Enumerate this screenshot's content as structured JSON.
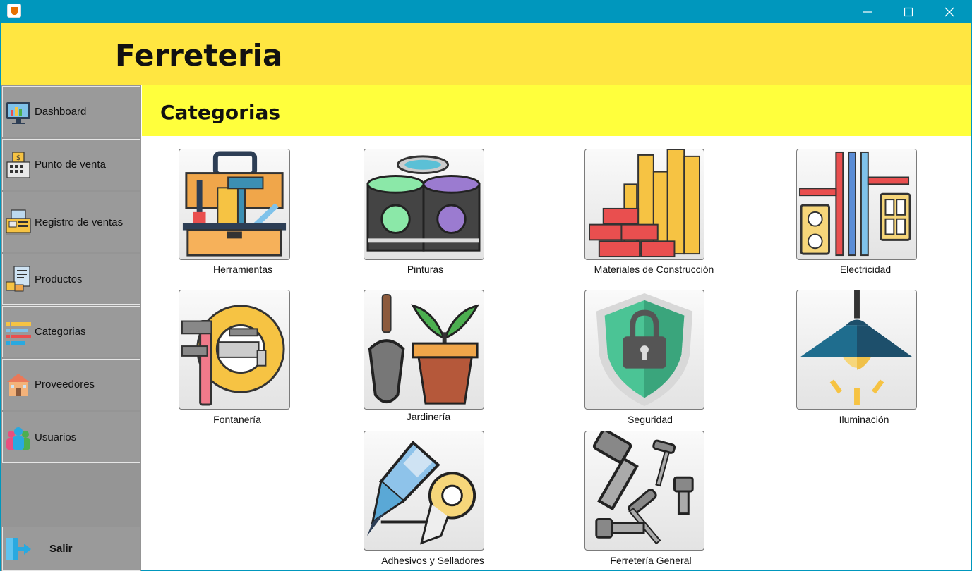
{
  "window": {
    "icon": "java-icon",
    "controls": [
      "minimize-icon",
      "maximize-icon",
      "close-icon"
    ]
  },
  "app": {
    "title": "Ferreteria"
  },
  "sidebar": {
    "items": [
      {
        "label": "Dashboard",
        "icon": "dashboard-icon"
      },
      {
        "label": "Punto de venta",
        "icon": "cash-register-icon"
      },
      {
        "label": "Registro de ventas",
        "icon": "sales-record-icon"
      },
      {
        "label": "Productos",
        "icon": "products-icon"
      },
      {
        "label": "Categorias",
        "icon": "categories-icon"
      },
      {
        "label": "Proveedores",
        "icon": "suppliers-icon"
      },
      {
        "label": "Usuarios",
        "icon": "users-icon"
      }
    ],
    "logout": {
      "label": "Salir",
      "icon": "logout-icon"
    }
  },
  "page": {
    "title": "Categorias"
  },
  "categories": [
    {
      "label": "Herramientas",
      "icon": "toolbox-icon"
    },
    {
      "label": "Pinturas",
      "icon": "paint-cans-icon"
    },
    {
      "label": "Materiales de Construcción",
      "icon": "bricks-lumber-icon"
    },
    {
      "label": "Electricidad",
      "icon": "electrical-outlet-icon"
    },
    {
      "label": "Fontanería",
      "icon": "plumbing-icon"
    },
    {
      "label": "Jardinería",
      "icon": "gardening-icon"
    },
    {
      "label": "Seguridad",
      "icon": "security-shield-icon"
    },
    {
      "label": "Iluminación",
      "icon": "lamp-icon"
    },
    {
      "label": "Adhesivos y Selladores",
      "icon": "adhesive-tape-icon"
    },
    {
      "label": "Ferretería General",
      "icon": "bolts-nails-icon"
    }
  ],
  "colors": {
    "titlebar": "#0097bd",
    "brand_bar": "#ffe641",
    "header_bar": "#ffff3c",
    "sidebar": "#959595"
  }
}
